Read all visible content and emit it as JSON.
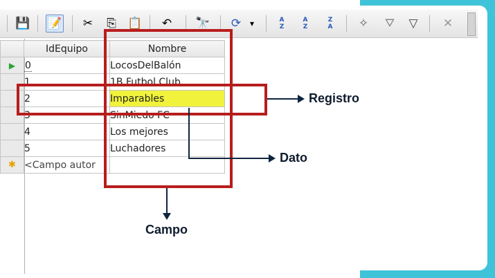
{
  "toolbar": {
    "buttons": [
      {
        "icon": "save-icon",
        "glyph": "💾"
      },
      {
        "icon": "edit-icon",
        "glyph": "📝"
      },
      {
        "icon": "cut-icon",
        "glyph": "✂"
      },
      {
        "icon": "copy-icon",
        "glyph": "⎘"
      },
      {
        "icon": "paste-icon",
        "glyph": "📋"
      },
      {
        "icon": "undo-icon",
        "glyph": "↶"
      },
      {
        "icon": "find-icon",
        "glyph": "🔭"
      },
      {
        "icon": "refresh-icon",
        "glyph": "⟳"
      },
      {
        "icon": "dropdown-arrow-icon",
        "glyph": "▾"
      },
      {
        "icon": "sort-az-icon",
        "top": "A",
        "bottom": "Z"
      },
      {
        "icon": "sort-ascending-icon",
        "top": "A",
        "bottom": "Z"
      },
      {
        "icon": "sort-descending-icon",
        "top": "Z",
        "bottom": "A"
      },
      {
        "icon": "autofilter-icon",
        "glyph": "✧"
      },
      {
        "icon": "standard-filter-icon",
        "glyph": "⛛"
      },
      {
        "icon": "filter-icon",
        "glyph": "▽"
      },
      {
        "icon": "remove-filter-icon",
        "glyph": "✕"
      }
    ]
  },
  "table": {
    "headers": {
      "col1": "IdEquipo",
      "col2": "Nombre"
    },
    "rows": [
      {
        "id": "0",
        "name": "LocosDelBalón"
      },
      {
        "id": "1",
        "name": "1B Futbol Club"
      },
      {
        "id": "2",
        "name": "Imparables"
      },
      {
        "id": "3",
        "name": "SinMiedo FC"
      },
      {
        "id": "4",
        "name": "Los mejores"
      },
      {
        "id": "5",
        "name": "Luchadores"
      }
    ],
    "new_row_text": "<Campo autor",
    "highlight_color": "#f0f23c"
  },
  "annotations": {
    "registro": "Registro",
    "dato": "Dato",
    "campo": "Campo",
    "box_color": "#b81d1d",
    "arrow_color": "#0f2440"
  },
  "colors": {
    "accent_teal": "#3fc3d8"
  }
}
